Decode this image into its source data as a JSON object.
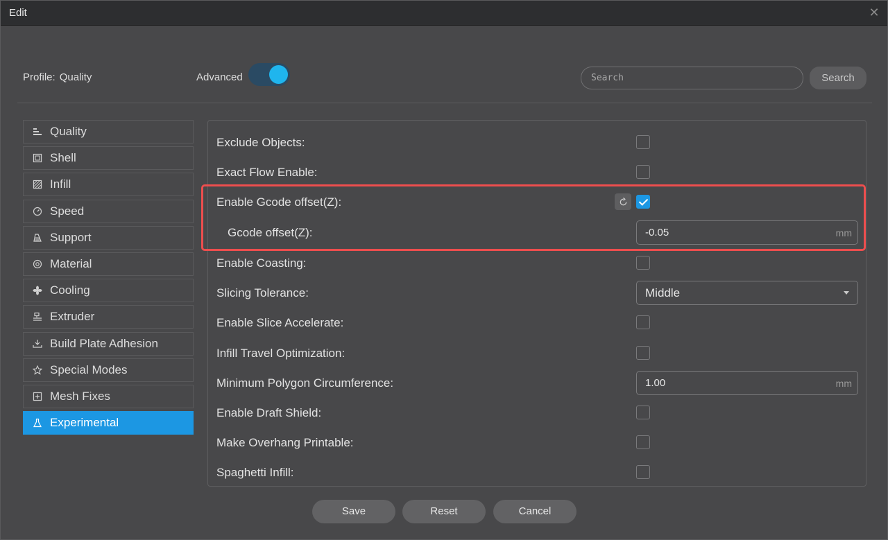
{
  "window": {
    "title": "Edit"
  },
  "header": {
    "profile_label": "Profile:",
    "profile_value": "Quality",
    "advanced_label": "Advanced",
    "advanced_on": true,
    "search_placeholder": "Search",
    "search_button": "Search"
  },
  "sidebar": {
    "items": [
      {
        "label": "Quality",
        "icon": "quality-icon"
      },
      {
        "label": "Shell",
        "icon": "shell-icon"
      },
      {
        "label": "Infill",
        "icon": "infill-icon"
      },
      {
        "label": "Speed",
        "icon": "speed-icon"
      },
      {
        "label": "Support",
        "icon": "support-icon"
      },
      {
        "label": "Material",
        "icon": "material-icon"
      },
      {
        "label": "Cooling",
        "icon": "cooling-fan-icon"
      },
      {
        "label": "Extruder",
        "icon": "extruder-icon"
      },
      {
        "label": "Build Plate Adhesion",
        "icon": "build-plate-icon"
      },
      {
        "label": "Special Modes",
        "icon": "star-icon"
      },
      {
        "label": "Mesh Fixes",
        "icon": "mesh-fix-icon"
      },
      {
        "label": "Experimental",
        "icon": "flask-icon",
        "active": true
      }
    ]
  },
  "settings": {
    "exclude_objects": {
      "label": "Exclude Objects:",
      "checked": false
    },
    "exact_flow": {
      "label": "Exact Flow Enable:",
      "checked": false
    },
    "gcode_offset_enable": {
      "label": "Enable Gcode offset(Z):",
      "checked": true
    },
    "gcode_offset": {
      "label": "Gcode offset(Z):",
      "value": "-0.05",
      "unit": "mm"
    },
    "coasting": {
      "label": "Enable Coasting:",
      "checked": false
    },
    "slicing_tolerance": {
      "label": "Slicing Tolerance:",
      "value": "Middle"
    },
    "slice_accelerate": {
      "label": "Enable Slice Accelerate:",
      "checked": false
    },
    "infill_travel": {
      "label": "Infill Travel Optimization:",
      "checked": false
    },
    "min_polygon": {
      "label": "Minimum Polygon Circumference:",
      "value": "1.00",
      "unit": "mm"
    },
    "draft_shield": {
      "label": "Enable Draft Shield:",
      "checked": false
    },
    "overhang": {
      "label": "Make Overhang Printable:",
      "checked": false
    },
    "spaghetti": {
      "label": "Spaghetti Infill:",
      "checked": false
    }
  },
  "footer": {
    "save": "Save",
    "reset": "Reset",
    "cancel": "Cancel"
  },
  "colors": {
    "accent": "#1c97e3",
    "highlight": "#ee4e4e",
    "toggle_knob": "#1fb5ee"
  }
}
